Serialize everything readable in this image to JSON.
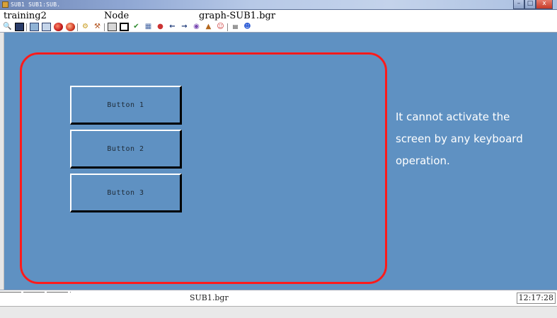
{
  "window": {
    "title": "SUB1 SUB1:SUB.",
    "controls": {
      "minimize": "–",
      "maximize": "□",
      "close": "x"
    }
  },
  "info": {
    "project": "training2",
    "node": "Node",
    "graph": "graph-SUB1.bgr"
  },
  "toolbar": {
    "icons": [
      "magnify-icon",
      "save-icon",
      "monitor-up-icon",
      "chart-icon",
      "red-ball-icon",
      "red-ball-2-icon",
      "gear-lamp-icon",
      "tools-icon",
      "crane-icon",
      "select-box-icon",
      "check-icon",
      "network-icon",
      "palette-icon",
      "arrow-left-icon",
      "arrow-right-icon",
      "globe-icon",
      "graph-icon",
      "person-icon",
      "calculator-icon",
      "figure-icon"
    ]
  },
  "screen": {
    "buttons": [
      "Button 1",
      "Button 2",
      "Button 3"
    ],
    "note_lines": [
      "It cannot activate the",
      "screen by any keyboard",
      "operation."
    ],
    "outline_color": "#ff1b1b",
    "background": "#5f91c2"
  },
  "status": {
    "file": "SUB1.bgr",
    "time": "12:17:28"
  }
}
